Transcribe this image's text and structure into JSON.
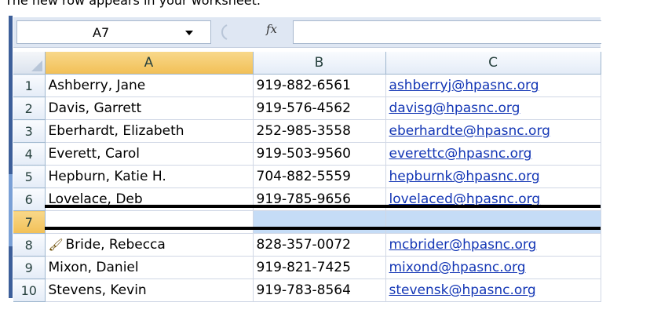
{
  "caption": "The new row appears in your worksheet.",
  "formula_bar": {
    "name_box": "A7",
    "fx_label": "fx",
    "formula": ""
  },
  "columns": [
    "A",
    "B",
    "C"
  ],
  "rows": [
    {
      "num": "1",
      "name": "Ashberry, Jane",
      "phone": "919-882-6561",
      "email": "ashberryj@hpasnc.org"
    },
    {
      "num": "2",
      "name": "Davis, Garrett",
      "phone": "919-576-4562",
      "email": "davisg@hpasnc.org"
    },
    {
      "num": "3",
      "name": "Eberhardt, Elizabeth",
      "phone": "252-985-3558",
      "email": "eberhardte@hpasnc.org"
    },
    {
      "num": "4",
      "name": "Everett, Carol",
      "phone": "919-503-9560",
      "email": "everettc@hpasnc.org"
    },
    {
      "num": "5",
      "name": "Hepburn, Katie H.",
      "phone": "704-882-5559",
      "email": "hepburnk@hpasnc.org"
    },
    {
      "num": "6",
      "name": "Lovelace, Deb",
      "phone": "919-785-9656",
      "email": "lovelaced@hpasnc.org"
    },
    {
      "num": "7",
      "name": "",
      "phone": "",
      "email": ""
    },
    {
      "num": "8",
      "name": "Bride, Rebecca",
      "phone": "828-357-0072",
      "email": "mcbrider@hpasnc.org"
    },
    {
      "num": "9",
      "name": "Mixon, Daniel",
      "phone": "919-821-7425",
      "email": "mixond@hpasnc.org"
    },
    {
      "num": "10",
      "name": "Stevens, Kevin",
      "phone": "919-783-8564",
      "email": "stevensk@hpasnc.org"
    }
  ],
  "selected_row": "7",
  "selected_column": "A",
  "icons": {
    "insert_options": "paintbrush-icon"
  },
  "colors": {
    "link": "#1336b5",
    "selection": "#c5dcf6",
    "header_highlight": "#f2c057"
  }
}
